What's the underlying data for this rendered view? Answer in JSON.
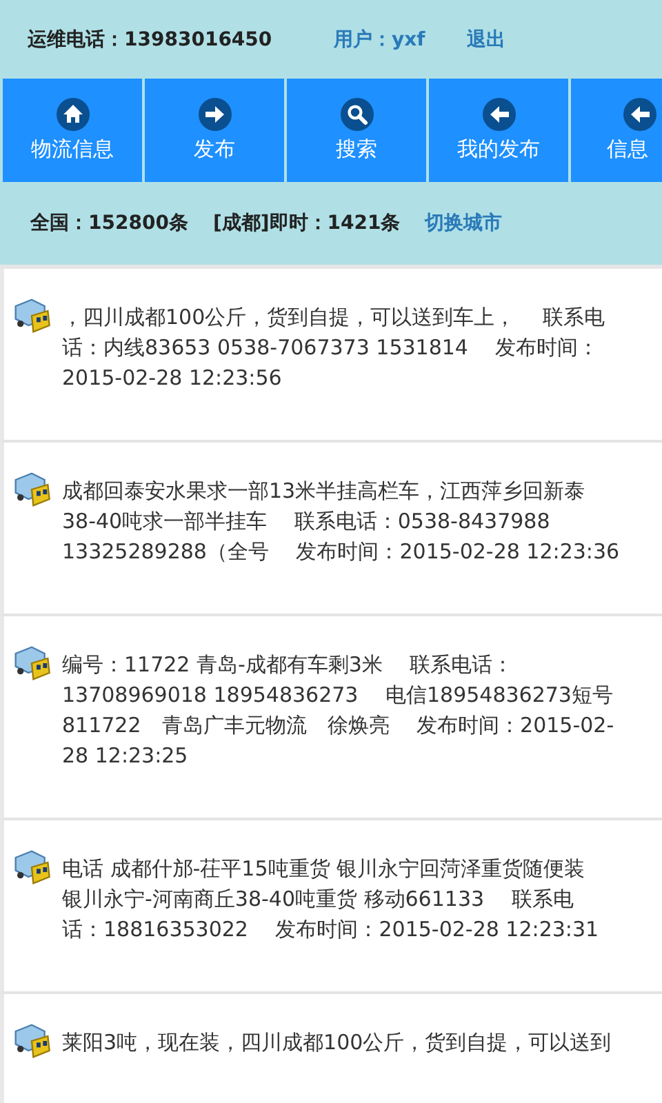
{
  "top_bar": {
    "hotline": "运维电话：13983016450",
    "user": "用户：yxf",
    "logout": "退出"
  },
  "nav": [
    {
      "kind": "home",
      "label": "物流信息"
    },
    {
      "kind": "forward",
      "label": "发布"
    },
    {
      "kind": "search",
      "label": "搜索"
    },
    {
      "kind": "back",
      "label": "我的发布"
    },
    {
      "kind": "back",
      "label": "信息"
    }
  ],
  "stats": {
    "national": "全国：152800条",
    "local": "[成都]即时：1421条",
    "switch_city": "切换城市"
  },
  "listings": [
    {
      "lines": [
        "，四川成都100公斤，货到自提，可以送到车上，　 联系电",
        "话：内线83653 0538-7067373 1531814　 发布时间：",
        "2015-02-28 12:23:56"
      ]
    },
    {
      "lines": [
        "成都回泰安水果求一部13米半挂高栏车，江西萍乡回新泰",
        "38-40吨求一部半挂车　 联系电话：0538-8437988",
        "13325289288（全号　 发布时间：2015-02-28 12:23:36"
      ]
    },
    {
      "lines": [
        "编号：11722 青岛-成都有车剩3米　 联系电话：",
        "13708969018 18954836273　 电信18954836273短号",
        "811722　青岛广丰元物流　徐焕亮　 发布时间：2015-02-",
        "28 12:23:25"
      ]
    },
    {
      "lines": [
        "电话 成都什邡-茌平15吨重货 银川永宁回菏泽重货随便装",
        "银川永宁-河南商丘38-40吨重货 移动661133　 联系电",
        "话：18816353022　 发布时间：2015-02-28 12:23:31"
      ]
    },
    {
      "lines": [
        "莱阳3吨，现在装，四川成都100公斤，货到自提，可以送到"
      ]
    }
  ]
}
